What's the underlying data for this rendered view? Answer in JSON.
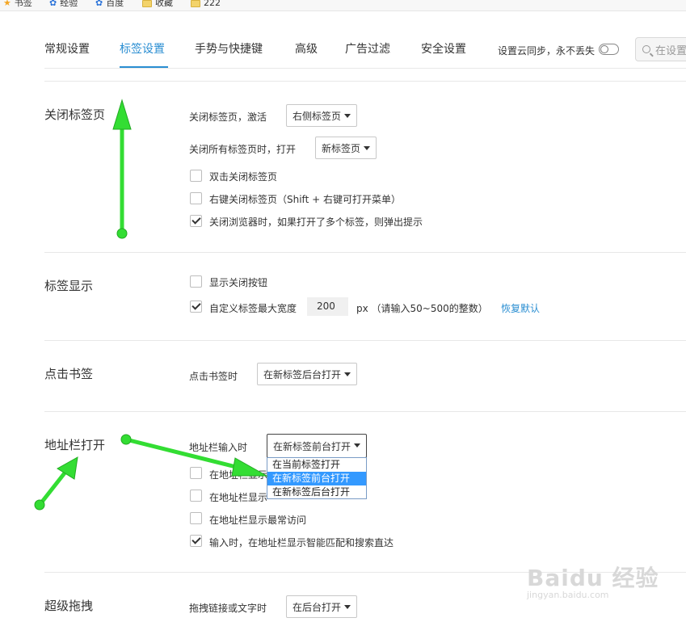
{
  "bookmarks_bar": {
    "items": [
      {
        "label": "书签",
        "icon": "star-icon"
      },
      {
        "label": "经验",
        "icon": "paw-icon"
      },
      {
        "label": "百度",
        "icon": "paw-icon"
      },
      {
        "label": "收藏",
        "icon": "folder-icon"
      },
      {
        "label": "222",
        "icon": "folder-icon"
      }
    ]
  },
  "tabs": [
    {
      "label": "常规设置"
    },
    {
      "label": "标签设置",
      "active": true
    },
    {
      "label": "手势与快捷键"
    },
    {
      "label": "高级"
    },
    {
      "label": "广告过滤"
    },
    {
      "label": "安全设置"
    }
  ],
  "sync": {
    "label": "设置云同步，永不丢失",
    "enabled": false
  },
  "search": {
    "placeholder": "在设置"
  },
  "sections": {
    "close_tab": {
      "title": "关闭标签页",
      "activate_label": "关闭标签页，激活",
      "activate_value": "右侧标签页",
      "close_all_label": "关闭所有标签页时，打开",
      "close_all_value": "新标签页",
      "double_click": {
        "label": "双击关闭标签页",
        "checked": false
      },
      "right_click": {
        "label": "右键关闭标签页（Shift + 右键可打开菜单）",
        "checked": false
      },
      "warn_on_close": {
        "label": "关闭浏览器时，如果打开了多个标签，则弹出提示",
        "checked": true
      }
    },
    "tab_display": {
      "title": "标签显示",
      "show_close": {
        "label": "显示关闭按钮",
        "checked": false
      },
      "custom_width": {
        "label": "自定义标签最大宽度",
        "checked": true
      },
      "width_value": "200",
      "width_hint": "px （请输入50~500的整数）",
      "restore_default": "恢复默认"
    },
    "click_bookmark": {
      "title": "点击书签",
      "label": "点击书签时",
      "value": "在新标签后台打开"
    },
    "address_bar": {
      "title": "地址栏打开",
      "label": "地址栏输入时",
      "value": "在新标签前台打开",
      "dropdown_options": [
        "在当前标签打开",
        "在新标签前台打开",
        "在新标签后台打开"
      ],
      "highlighted_index": 1,
      "option1_label": "在地址栏显示",
      "option2_label": "在地址栏显示",
      "option3": {
        "label": "在地址栏显示最常访问",
        "checked": false
      },
      "option4": {
        "label": "输入时，在地址栏显示智能匹配和搜索直达",
        "checked": true
      }
    },
    "super_drag": {
      "title": "超级拖拽",
      "label": "拖拽链接或文字时",
      "value": "在后台打开"
    }
  },
  "watermark": {
    "text": "Baidu 经验",
    "sub": "jingyan.baidu.com"
  },
  "colors": {
    "accent": "#2a8ed2",
    "arrow": "#33dd33",
    "highlight": "#3399ff"
  }
}
